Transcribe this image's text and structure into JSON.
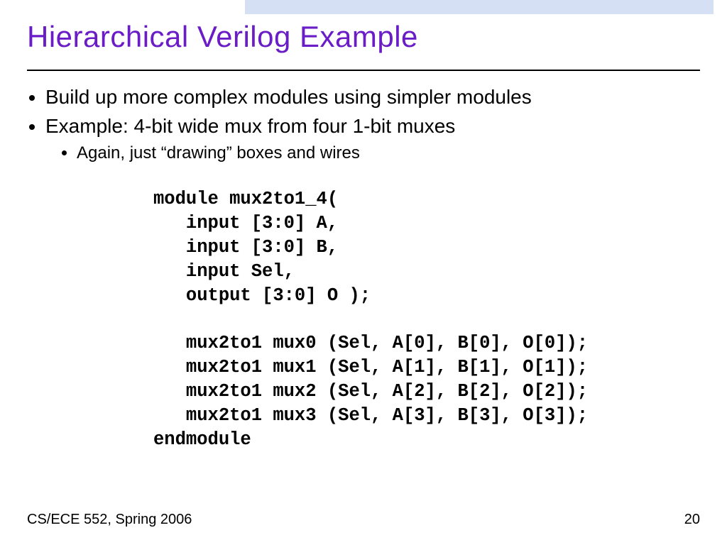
{
  "title": "Hierarchical Verilog Example",
  "bullets": {
    "b1": "Build up more complex modules using simpler modules",
    "b2": "Example: 4-bit wide mux from four 1-bit muxes",
    "b2a": "Again, just “drawing” boxes and wires"
  },
  "code": "module mux2to1_4(\n   input [3:0] A,\n   input [3:0] B,\n   input Sel,\n   output [3:0] O );\n\n   mux2to1 mux0 (Sel, A[0], B[0], O[0]);\n   mux2to1 mux1 (Sel, A[1], B[1], O[1]);\n   mux2to1 mux2 (Sel, A[2], B[2], O[2]);\n   mux2to1 mux3 (Sel, A[3], B[3], O[3]);\nendmodule",
  "footer": {
    "left": "CS/ECE 552, Spring 2006",
    "right": "20"
  }
}
